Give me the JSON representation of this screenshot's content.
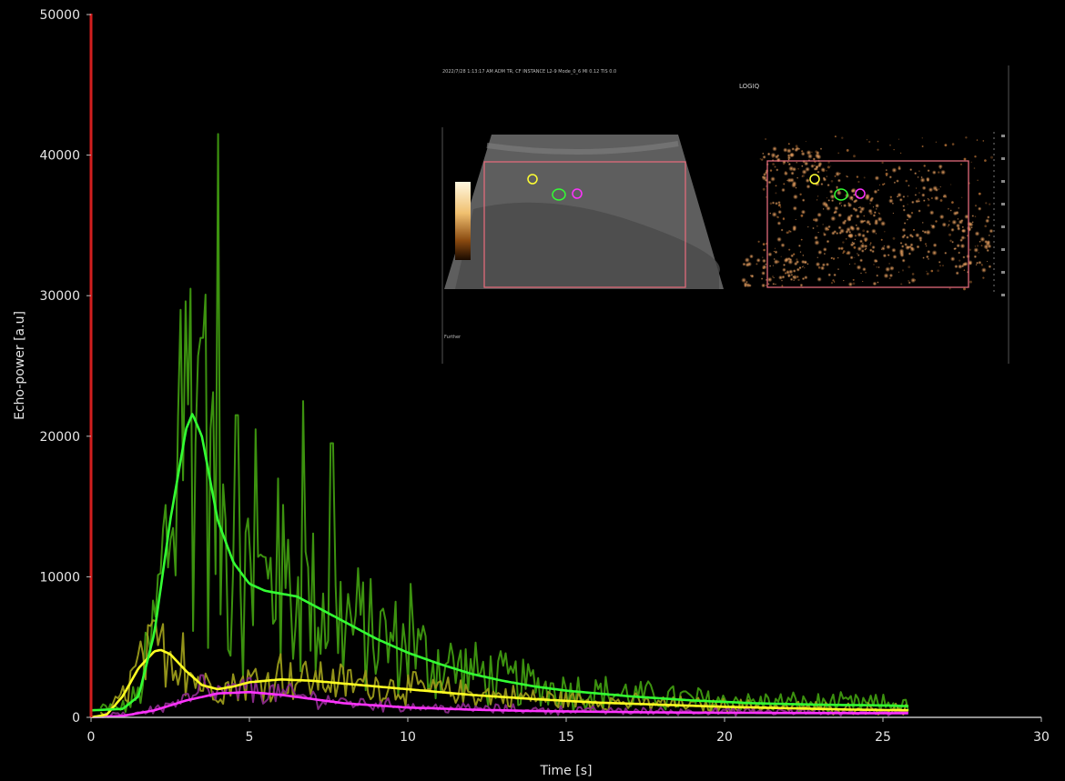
{
  "chart_data": {
    "type": "line",
    "xlabel": "Time [s]",
    "ylabel": "Echo-power [a.u]",
    "xlim": [
      0,
      30
    ],
    "ylim": [
      0,
      50000
    ],
    "xticks": [
      "0",
      "5",
      "10",
      "15",
      "20",
      "25",
      "30"
    ],
    "yticks": [
      "0",
      "10000",
      "20000",
      "30000",
      "40000",
      "50000"
    ],
    "grid": false,
    "colors": {
      "green_raw": "#3f9a10",
      "green_fit": "#33ff33",
      "yellow_raw": "#9a9a1a",
      "yellow_fit": "#ffff22",
      "magenta_raw": "#8a2a8a",
      "magenta_fit": "#ff33ff",
      "left_axis": "#d21e1e"
    },
    "series": [
      {
        "color_key": "green_fit",
        "x": [
          0,
          1.0,
          1.5,
          2.0,
          2.5,
          3.0,
          3.2,
          3.5,
          4.0,
          4.5,
          5.0,
          5.5,
          6.0,
          6.5,
          7.0,
          8.0,
          9.0,
          10.0,
          11.0,
          12.0,
          13.0,
          14.0,
          15.0,
          17.0,
          19.0,
          21.0,
          23.0,
          25.0,
          25.8
        ],
        "y": [
          500,
          600,
          1500,
          6000,
          14000,
          20500,
          21600,
          20000,
          14000,
          11000,
          9500,
          9000,
          8800,
          8600,
          8000,
          6800,
          5600,
          4600,
          3800,
          3100,
          2600,
          2200,
          1900,
          1500,
          1200,
          1000,
          900,
          850,
          800
        ]
      },
      {
        "color_key": "yellow_fit",
        "x": [
          0,
          0.5,
          1.0,
          1.5,
          2.0,
          2.2,
          2.5,
          3.0,
          3.5,
          4.0,
          4.5,
          5.0,
          6.0,
          7.0,
          8.0,
          9.0,
          10.0,
          12.0,
          14.0,
          16.0,
          18.0,
          20.0,
          22.0,
          24.0,
          25.8
        ],
        "y": [
          0,
          200,
          1500,
          3500,
          4700,
          4800,
          4500,
          3300,
          2300,
          2000,
          2200,
          2500,
          2700,
          2600,
          2400,
          2200,
          2000,
          1600,
          1300,
          1050,
          900,
          750,
          650,
          550,
          500
        ]
      },
      {
        "color_key": "magenta_fit",
        "x": [
          0,
          1.0,
          2.0,
          3.0,
          4.0,
          5.0,
          6.0,
          7.0,
          8.0,
          10.0,
          12.0,
          14.0,
          16.0,
          18.0,
          20.0,
          22.0,
          24.0,
          25.8
        ],
        "y": [
          0,
          100,
          500,
          1200,
          1700,
          1800,
          1600,
          1300,
          1000,
          700,
          550,
          450,
          400,
          350,
          330,
          310,
          300,
          300
        ]
      }
    ]
  },
  "inset": {
    "header_text": "2022/7/28 1:13:17 AM  ADM  TR, CF  INSTANCE  L2-9  Mode_0_6  MI 0.12  TIS 0.0",
    "logo": "LOGIQ",
    "footer_text": "Further",
    "roi_colors": [
      "#ffff33",
      "#33ff33",
      "#ff33ff"
    ]
  }
}
